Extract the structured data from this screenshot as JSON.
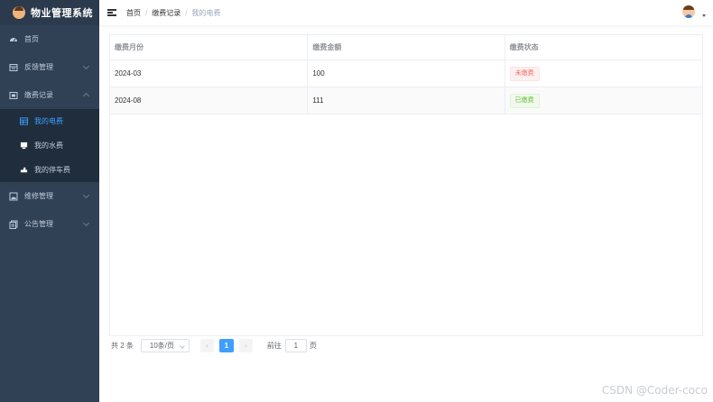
{
  "app": {
    "title": "物业管理系统"
  },
  "sidebar": {
    "items": [
      {
        "label": "首页",
        "icon": "dashboard-icon"
      },
      {
        "label": "反馈管理",
        "icon": "calendar-icon"
      },
      {
        "label": "缴费记录",
        "icon": "component-icon"
      },
      {
        "label": "维修管理",
        "icon": "image-icon"
      },
      {
        "label": "公告管理",
        "icon": "documentation-icon"
      }
    ],
    "submenu": [
      {
        "label": "我的电费",
        "icon": "table-icon",
        "active": true
      },
      {
        "label": "我的水费",
        "icon": "monitor-icon",
        "active": false
      },
      {
        "label": "我的停车费",
        "icon": "car-icon",
        "active": false
      }
    ]
  },
  "breadcrumb": [
    "首页",
    "缴费记录",
    "我的电费"
  ],
  "table": {
    "columns": [
      "缴费月份",
      "缴费金额",
      "缴费状态"
    ],
    "rows": [
      {
        "month": "2024-03",
        "amount": "100",
        "status": "未缴费",
        "status_type": "danger"
      },
      {
        "month": "2024-08",
        "amount": "111",
        "status": "已缴费",
        "status_type": "success"
      }
    ]
  },
  "pagination": {
    "total": "共 2 条",
    "page_size": "10条/页",
    "current_page": "1",
    "goto_prefix": "前往",
    "goto_value": "1",
    "goto_suffix": "页"
  },
  "watermark": "CSDN @Coder-coco",
  "colors": {
    "sidebar_bg": "#304156",
    "active": "#409eff",
    "danger": "#f56c6c",
    "success": "#67c23a"
  }
}
